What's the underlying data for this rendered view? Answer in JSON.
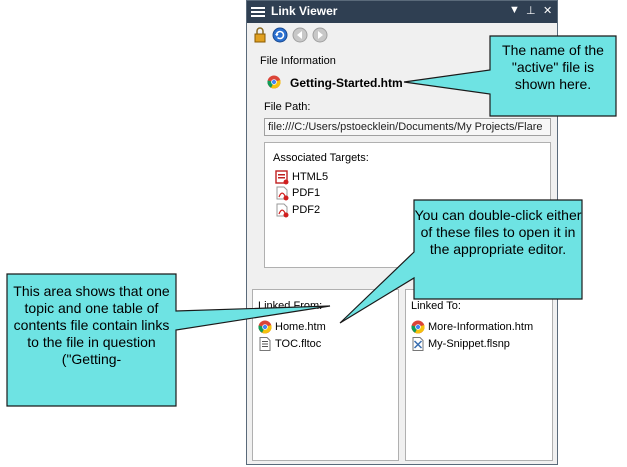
{
  "panel": {
    "title": "Link Viewer",
    "title_buttons": [
      "▼",
      "⊥",
      "✕"
    ]
  },
  "file_info": {
    "label": "File Information",
    "file_name": "Getting-Started.htm",
    "path_label": "File Path:",
    "path_value": "file:///C:/Users/pstoecklein/Documents/My Projects/Flare"
  },
  "targets": {
    "label": "Associated Targets:",
    "items": [
      {
        "label": "HTML5",
        "icon": "html5-target-icon"
      },
      {
        "label": "PDF1",
        "icon": "pdf-target-icon"
      },
      {
        "label": "PDF2",
        "icon": "pdf-target-icon"
      }
    ]
  },
  "linked_from": {
    "label": "Linked From:",
    "items": [
      {
        "label": "Home.htm",
        "icon": "chrome-icon"
      },
      {
        "label": "TOC.fltoc",
        "icon": "toc-file-icon"
      }
    ]
  },
  "linked_to": {
    "label": "Linked To:",
    "items": [
      {
        "label": "More-Information.htm",
        "icon": "chrome-icon"
      },
      {
        "label": "My-Snippet.flsnp",
        "icon": "snippet-file-icon"
      }
    ]
  },
  "callouts": {
    "active_file": "The name of the \"active\" file is shown here.",
    "double_click": "You can double-click either of these files to open it in the appropriate editor.",
    "area": "This area shows that one topic and one table of contents file contain links to the file in question (\"Getting-"
  },
  "colors": {
    "titlebar": "#2f3f52",
    "callout_fill": "#6ee3e3",
    "callout_border": "#1a1a1a"
  }
}
